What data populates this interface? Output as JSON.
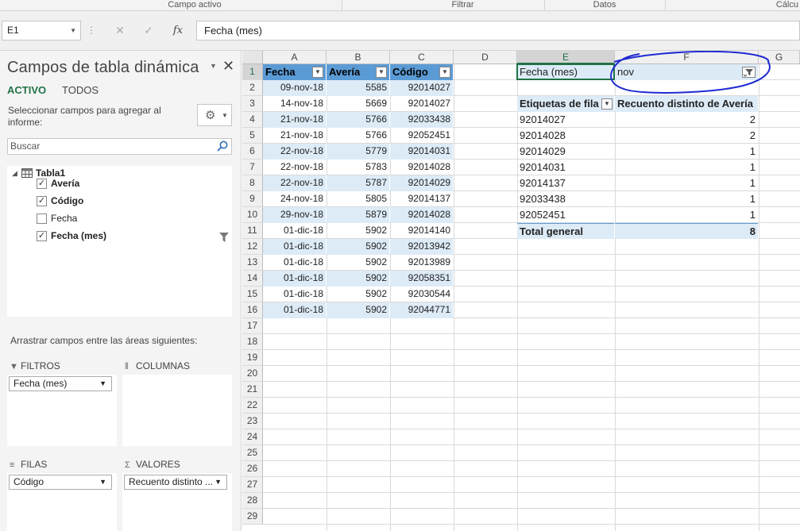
{
  "ribbon": {
    "groups": [
      "Campo activo",
      "Filtrar",
      "Datos",
      "Cálcu"
    ]
  },
  "formula_bar": {
    "name_box": "E1",
    "fx_label": "fx",
    "content": "Fecha (mes)"
  },
  "panel": {
    "title": "Campos de tabla dinámica",
    "tab_active": "ACTIVO",
    "tab_all": "TODOS",
    "select_label": "Seleccionar campos para agregar al informe:",
    "search_placeholder": "Buscar",
    "table_name": "Tabla1",
    "fields": [
      {
        "label": "Avería",
        "checked": true
      },
      {
        "label": "Código",
        "checked": true
      },
      {
        "label": "Fecha",
        "checked": false
      },
      {
        "label": "Fecha (mes)",
        "checked": true
      }
    ],
    "drag_label": "Arrastrar campos entre las áreas siguientes:",
    "areas": {
      "filters": {
        "title": "FILTROS",
        "item": "Fecha (mes)"
      },
      "columns": {
        "title": "COLUMNAS",
        "item": ""
      },
      "rows": {
        "title": "FILAS",
        "item": "Código"
      },
      "values": {
        "title": "VALORES",
        "item": "Recuento distinto ..."
      }
    }
  },
  "sheet": {
    "columns": [
      "A",
      "B",
      "C",
      "D",
      "E",
      "F",
      "G"
    ],
    "selected_column": "E",
    "selected_row": "1",
    "row_numbers": [
      "1",
      "2",
      "3",
      "4",
      "5",
      "6",
      "7",
      "8",
      "9",
      "10",
      "11",
      "12",
      "13",
      "14",
      "15",
      "16",
      "17",
      "18",
      "19",
      "20",
      "21",
      "22",
      "23",
      "24",
      "25",
      "26",
      "27",
      "28",
      "29"
    ],
    "table": {
      "headers": [
        "Fecha",
        "Avería",
        "Código"
      ],
      "rows": [
        [
          "09-nov-18",
          "5585",
          "92014027"
        ],
        [
          "14-nov-18",
          "5669",
          "92014027"
        ],
        [
          "21-nov-18",
          "5766",
          "92033438"
        ],
        [
          "21-nov-18",
          "5766",
          "92052451"
        ],
        [
          "22-nov-18",
          "5779",
          "92014031"
        ],
        [
          "22-nov-18",
          "5783",
          "92014028"
        ],
        [
          "22-nov-18",
          "5787",
          "92014029"
        ],
        [
          "24-nov-18",
          "5805",
          "92014137"
        ],
        [
          "29-nov-18",
          "5879",
          "92014028"
        ],
        [
          "01-dic-18",
          "5902",
          "92014140"
        ],
        [
          "01-dic-18",
          "5902",
          "92013942"
        ],
        [
          "01-dic-18",
          "5902",
          "92013989"
        ],
        [
          "01-dic-18",
          "5902",
          "92058351"
        ],
        [
          "01-dic-18",
          "5902",
          "92030544"
        ],
        [
          "01-dic-18",
          "5902",
          "92044771"
        ]
      ]
    },
    "pivot": {
      "filter_label": "Fecha (mes)",
      "filter_value": "nov",
      "row_header": "Etiquetas de fila",
      "value_header": "Recuento distinto de Avería",
      "rows": [
        [
          "92014027",
          "2"
        ],
        [
          "92014028",
          "2"
        ],
        [
          "92014029",
          "1"
        ],
        [
          "92014031",
          "1"
        ],
        [
          "92014137",
          "1"
        ],
        [
          "92033438",
          "1"
        ],
        [
          "92052451",
          "1"
        ]
      ],
      "total_label": "Total general",
      "total_value": "8"
    }
  },
  "colors": {
    "accent": "#217346",
    "table_header": "#5b9bd5",
    "band": "#ddebf7",
    "ink_annotation": "#1f2bd1"
  }
}
